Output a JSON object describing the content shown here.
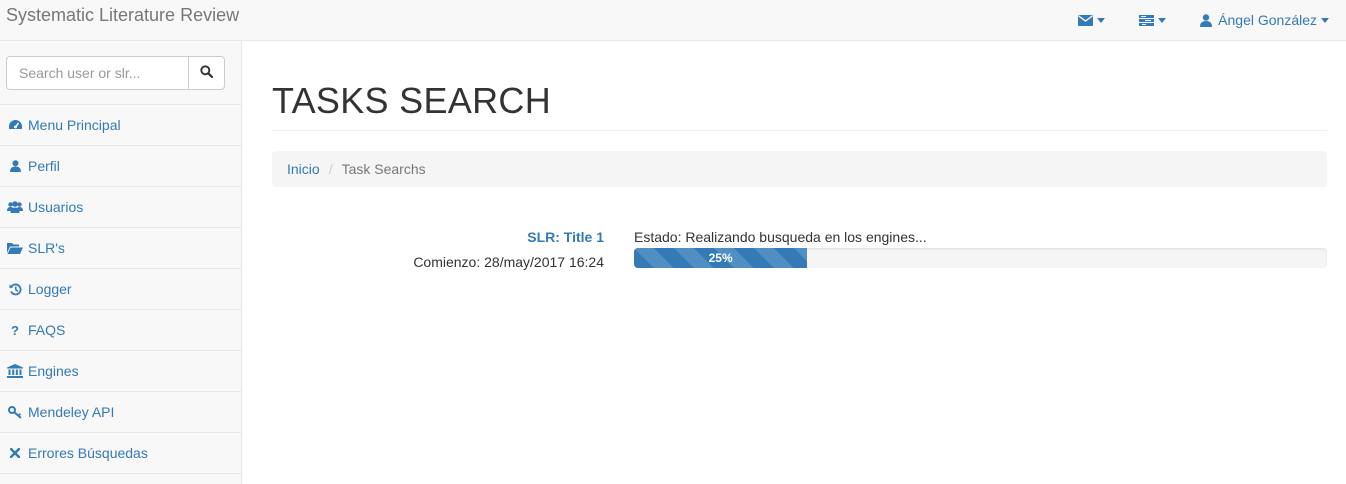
{
  "app": {
    "title": "Systematic Literature Review"
  },
  "navbar": {
    "messages_icon": "envelope-icon",
    "tasks_icon": "tasks-icon",
    "user_icon": "user-icon",
    "user_name": "Ángel González"
  },
  "sidebar": {
    "search": {
      "placeholder": "Search user or slr...",
      "value": "",
      "button_icon": "search-icon"
    },
    "items": [
      {
        "label": "Menu Principal",
        "icon": "dashboard-icon"
      },
      {
        "label": "Perfil",
        "icon": "user-icon"
      },
      {
        "label": "Usuarios",
        "icon": "users-icon"
      },
      {
        "label": "SLR's",
        "icon": "folder-open-icon"
      },
      {
        "label": "Logger",
        "icon": "history-icon"
      },
      {
        "label": "FAQS",
        "icon": "question-icon"
      },
      {
        "label": "Engines",
        "icon": "bank-icon"
      },
      {
        "label": "Mendeley API",
        "icon": "key-icon"
      },
      {
        "label": "Errores Búsquedas",
        "icon": "times-icon"
      }
    ]
  },
  "main": {
    "title": "TASKS SEARCH",
    "breadcrumb": {
      "home": "Inicio",
      "current": "Task Searchs"
    },
    "task": {
      "title": "SLR: Title 1",
      "start": "Comienzo: 28/may/2017 16:24",
      "status": "Estado: Realizando busqueda en los engines...",
      "progress_label": "25%",
      "progress_value": 0.25
    }
  },
  "colors": {
    "link": "#337ab7",
    "navbar_bg": "#f8f8f8",
    "progress": "#337ab7"
  }
}
